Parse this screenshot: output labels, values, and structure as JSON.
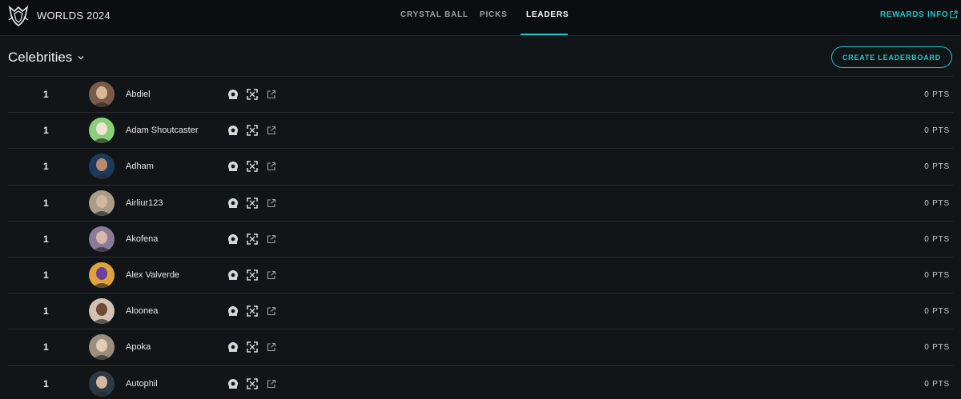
{
  "header": {
    "brand": "WORLDS 2024",
    "nav": [
      "CRYSTAL BALL",
      "PICKS",
      "LEADERS"
    ],
    "active_tab": "LEADERS",
    "rewards": "REWARDS",
    "info": "INFO"
  },
  "subheader": {
    "filter_label": "Celebrities",
    "create_button": "CREATE LEADERBOARD"
  },
  "colors": {
    "accent": "#1ec6c6",
    "background": "#111518",
    "topbar": "#0b0e10"
  },
  "rows": [
    {
      "rank": "1",
      "name": "Abdiel",
      "points": "0 PTS",
      "avatar_bg": "#7a5b48",
      "avatar_fg": "#d9b89a"
    },
    {
      "rank": "1",
      "name": "Adam Shoutcaster",
      "points": "0 PTS",
      "avatar_bg": "#8ad07a",
      "avatar_fg": "#f3e3d2"
    },
    {
      "rank": "1",
      "name": "Adham",
      "points": "0 PTS",
      "avatar_bg": "#1d3a5c",
      "avatar_fg": "#b98b6c"
    },
    {
      "rank": "1",
      "name": "Airliur123",
      "points": "0 PTS",
      "avatar_bg": "#a89e88",
      "avatar_fg": "#d3b79c"
    },
    {
      "rank": "1",
      "name": "Akofena",
      "points": "0 PTS",
      "avatar_bg": "#8a7b9b",
      "avatar_fg": "#d8b9a8"
    },
    {
      "rank": "1",
      "name": "Alex Valverde",
      "points": "0 PTS",
      "avatar_bg": "#e0a23a",
      "avatar_fg": "#6b3fa0"
    },
    {
      "rank": "1",
      "name": "Aloonea",
      "points": "0 PTS",
      "avatar_bg": "#d4c1b2",
      "avatar_fg": "#6e4a3a"
    },
    {
      "rank": "1",
      "name": "Apoka",
      "points": "0 PTS",
      "avatar_bg": "#9a8f7f",
      "avatar_fg": "#e2cdb4"
    },
    {
      "rank": "1",
      "name": "Autophil",
      "points": "0 PTS",
      "avatar_bg": "#2a3a46",
      "avatar_fg": "#d6b69c"
    }
  ]
}
